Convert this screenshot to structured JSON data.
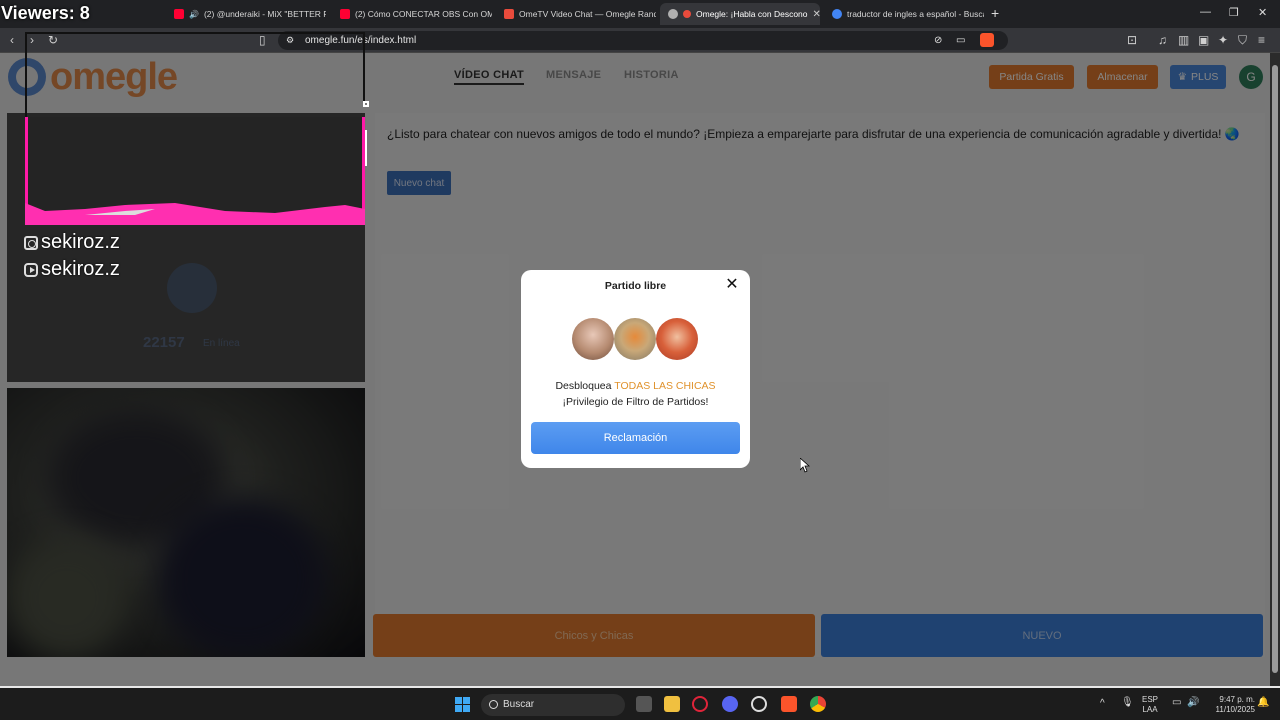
{
  "browser": {
    "tabs": [
      {
        "title": "(2) @underaiki - MiX \"BETTER RU",
        "favicon_color": "#ff0033",
        "active": false
      },
      {
        "title": "(2) Cómo CONECTAR OBS Con OME",
        "favicon_color": "#ff0033",
        "active": false
      },
      {
        "title": "OmeTV Video Chat — Omegle Rand",
        "favicon_color": "#e94b3c",
        "active": false
      },
      {
        "title": "Omegle: ¡Habla con Descono",
        "favicon_color": "#b0b0b0",
        "active": true
      },
      {
        "title": "traductor de ingles a español - Busca",
        "favicon_color": "#4285f4",
        "active": false
      }
    ],
    "new_tab": "+",
    "url": "omegle.fun/es/index.html"
  },
  "stream_overlay": {
    "viewers": "Viewers: 8",
    "social": [
      "sekiroz.z",
      "sekiroz.z"
    ]
  },
  "header": {
    "logo_text": "omegle",
    "nav": [
      {
        "label": "VÍDEO CHAT",
        "active": true
      },
      {
        "label": "MENSAJE",
        "active": false
      },
      {
        "label": "HISTORIA",
        "active": false
      }
    ],
    "buttons": {
      "free_match": "Partida Gratis",
      "store": "Almacenar",
      "plus": "PLUS"
    },
    "avatar_letter": "G"
  },
  "stats": {
    "count": "22157",
    "label": "En línea"
  },
  "chat": {
    "welcome": "¿Listo para chatear con nuevos amigos de todo el mundo? ¡Empieza a emparejarte para disfrutar de una experiencia de comunicación agradable y divertida! 🌏",
    "new_chat": "Nuevo chat",
    "gender_button": "Chicos y Chicas",
    "next_button": "NUEVO"
  },
  "modal": {
    "title": "Partido libre",
    "text_before": "Desbloquea ",
    "text_highlight": "TODAS LAS CHICAS",
    "text_after": " ¡Privilegio de Filtro de Partidos!",
    "claim_button": "Reclamación",
    "accent": "#e0922c"
  },
  "taskbar": {
    "search": "Buscar",
    "lang1": "ESP",
    "lang2": "LAA",
    "time": "9:47 p. m.",
    "date": "11/10/2025"
  },
  "colors": {
    "orange": "#e07a2e",
    "blue": "#3d7fd9",
    "pink": "#ff1aa8"
  }
}
